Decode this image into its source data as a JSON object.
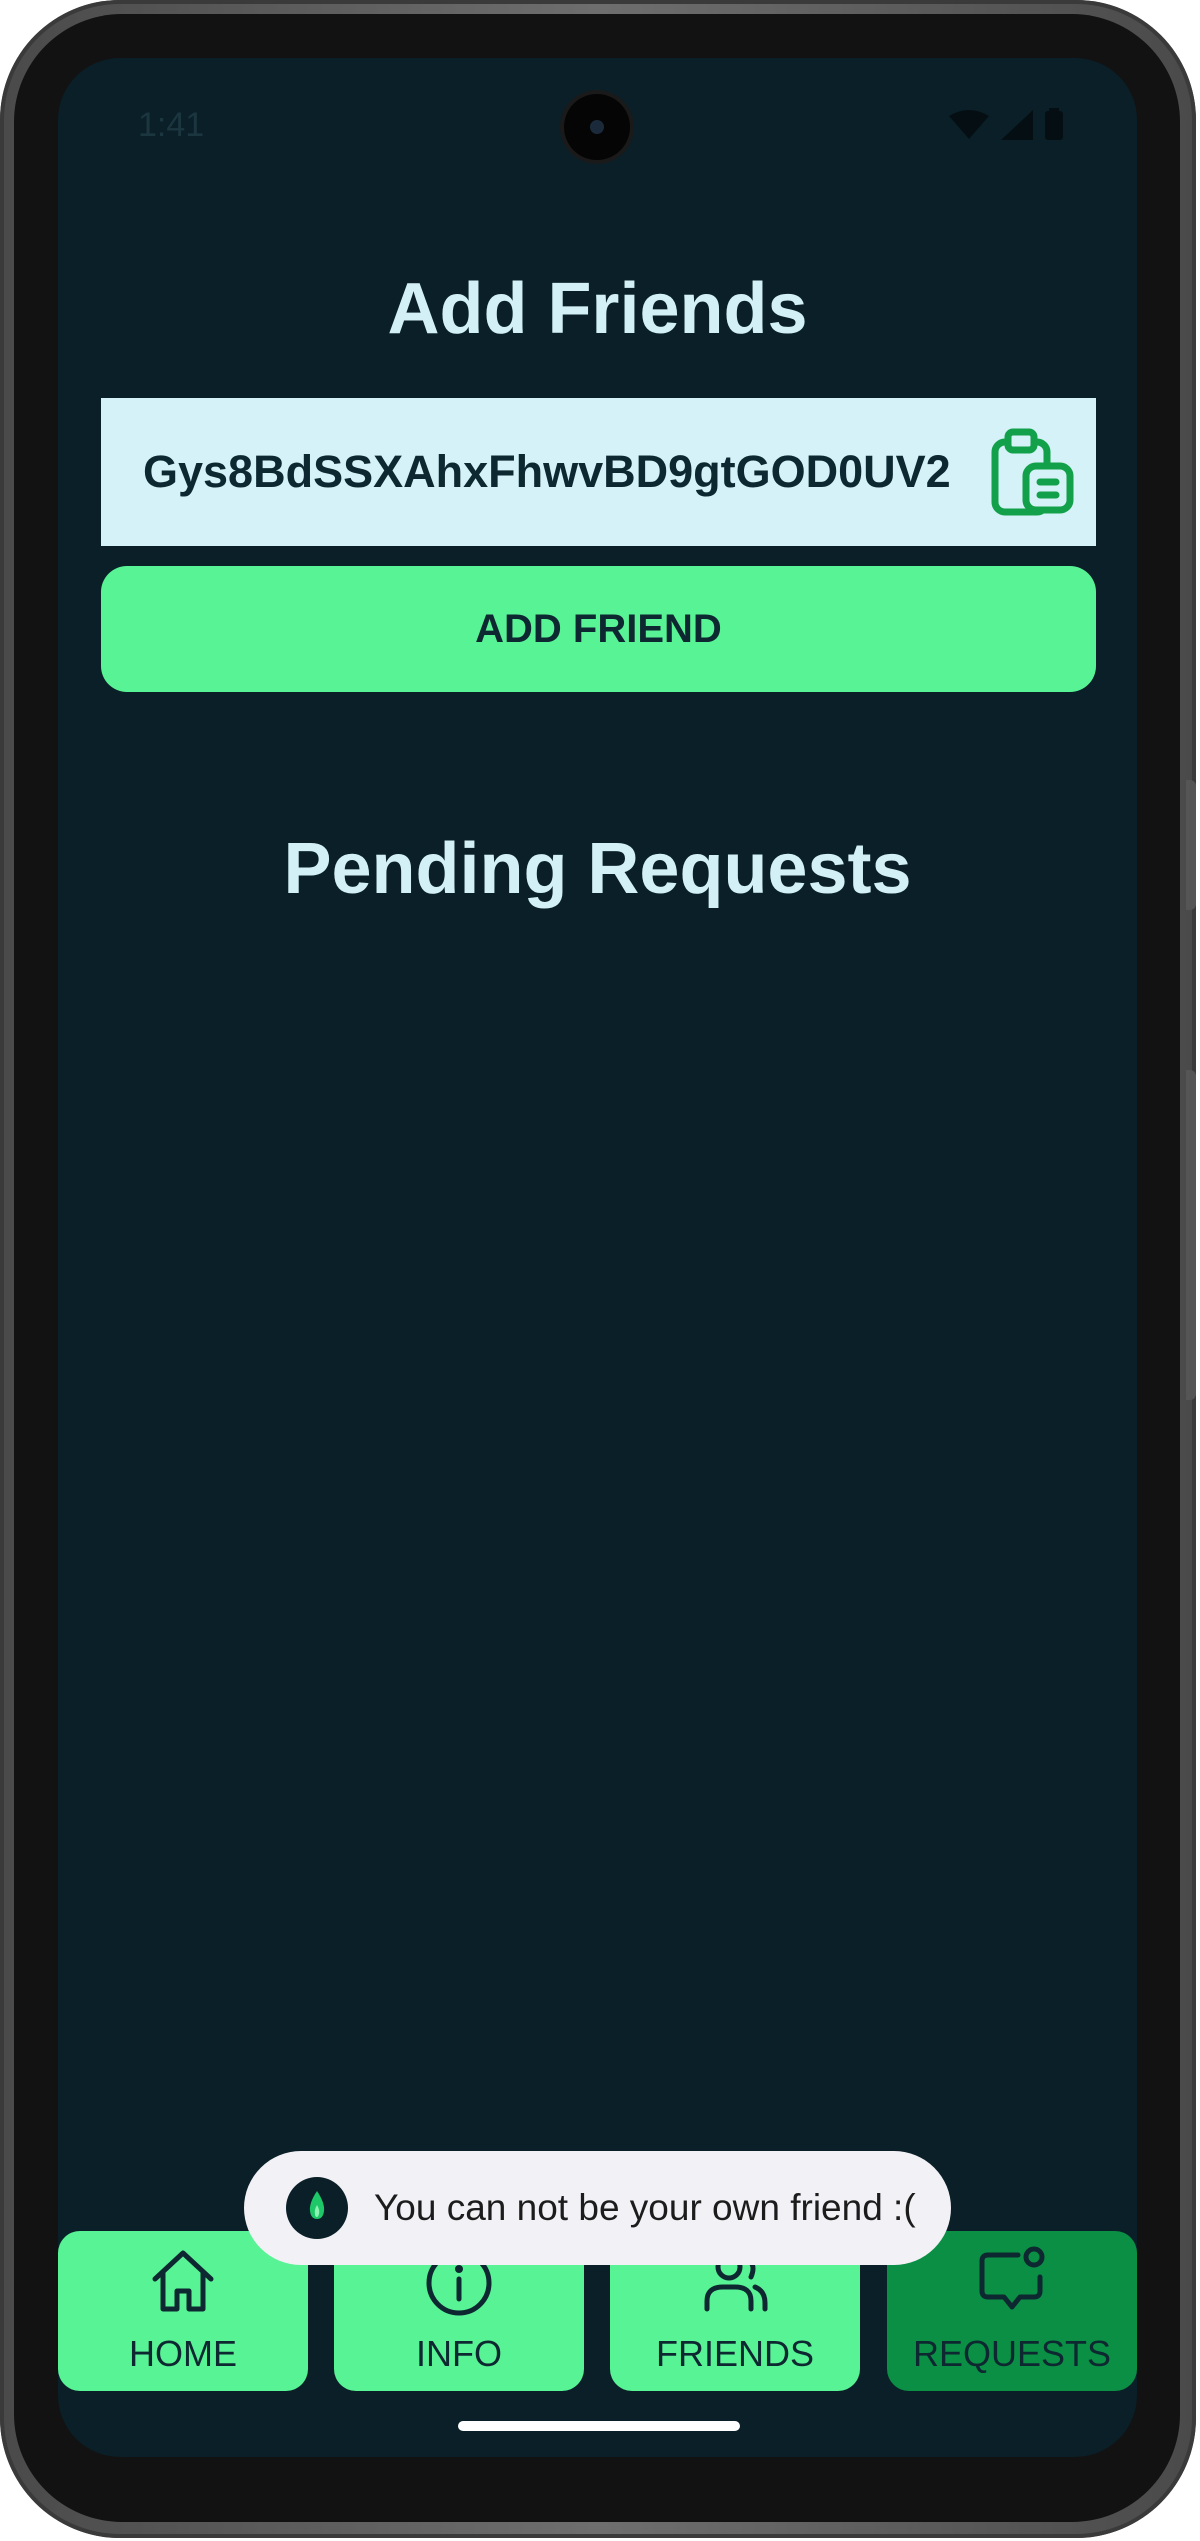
{
  "status_bar": {
    "time": "1:41"
  },
  "header": {
    "title": "Add Friends"
  },
  "friend_id_field": {
    "value": "Gys8BdSSXAhxFhwvBD9gtGOD0UV2",
    "paste_icon": "clipboard-paste-icon"
  },
  "add_button": {
    "label": "ADD FRIEND"
  },
  "pending": {
    "title": "Pending Requests",
    "items": []
  },
  "toast": {
    "message": "You can not be your own friend :("
  },
  "nav": {
    "items": [
      {
        "label": "HOME",
        "icon": "home-icon",
        "active": false
      },
      {
        "label": "INFO",
        "icon": "info-icon",
        "active": false
      },
      {
        "label": "FRIENDS",
        "icon": "friends-icon",
        "active": false
      },
      {
        "label": "REQUESTS",
        "icon": "chat-notification-icon",
        "active": true
      }
    ]
  },
  "colors": {
    "background": "#0a1f27",
    "accent": "#58f395",
    "accent_active": "#0b8f45",
    "field_bg": "#d4f2f7",
    "title_text": "#d2f0f5",
    "icon_green": "#13a04a"
  }
}
